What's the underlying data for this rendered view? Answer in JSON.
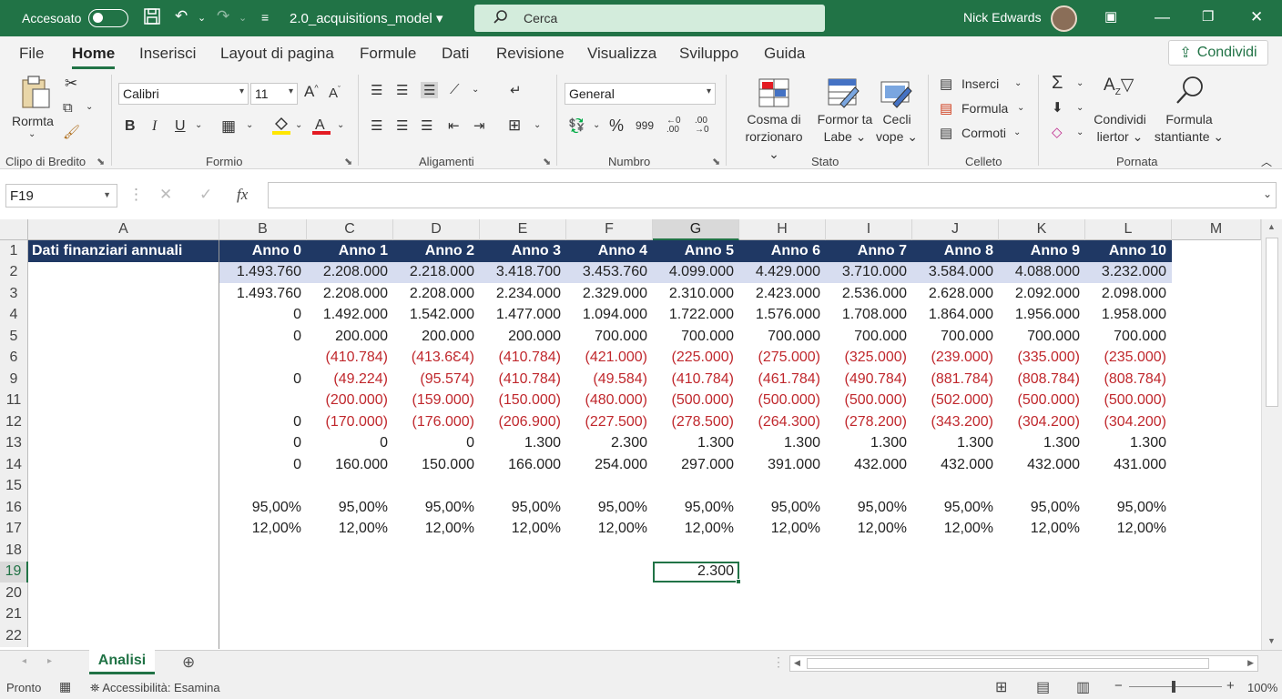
{
  "titlebar": {
    "autosave_label": "Accesoato",
    "filename": "2.0_acquisitions_model",
    "search_placeholder": "Cerca",
    "user_name": "Nick Edwards"
  },
  "ribbon_tabs": [
    "File",
    "Home",
    "Inserisci",
    "Layout di pagina",
    "Formule",
    "Dati",
    "Revisione",
    "Visualizza",
    "Sviluppo",
    "Guida"
  ],
  "share_label": "Condividi",
  "ribbon": {
    "paste_label": "Rormta",
    "font_name": "Calibri",
    "font_size": "11",
    "number_format": "General",
    "cond_format_label_1": "Cosma di",
    "cond_format_label_2": "rorzionaro",
    "format_table_label_1": "Formor ta",
    "format_table_label_2": "Labe",
    "cell_styles_label_1": "Cecli",
    "cell_styles_label_2": "vope",
    "insert_label": "Inserci",
    "format_label": "Formula",
    "delete_label": "Cormoti",
    "sort_label_1": "Condividi",
    "sort_label_2": "liertor",
    "find_label_1": "Formula",
    "find_label_2": "stantiante",
    "groups": {
      "clipboard": "Clipo di Bredito",
      "font": "Formio",
      "alignment": "Aligamenti",
      "number": "Numbro",
      "styles": "Stato",
      "cells": "Celleto",
      "editing": "Pornata"
    }
  },
  "formula_bar": {
    "name_box": "F19",
    "formula": ""
  },
  "sheet": {
    "columns": [
      "A",
      "B",
      "C",
      "D",
      "E",
      "F",
      "G",
      "H",
      "I",
      "J",
      "K",
      "L",
      "M"
    ],
    "selected_column": "G",
    "row_numbers": [
      "1",
      "2",
      "3",
      "4",
      "5",
      "6",
      "9",
      "11",
      "12",
      "13",
      "14",
      "15",
      "16",
      "17",
      "18",
      "19",
      "20",
      "21",
      "22"
    ],
    "selected_row": "19",
    "header_title": "Dati finanziari annuali",
    "years": [
      "Anno 0",
      "Anno 1",
      "Anno 2",
      "Anno 3",
      "Anno 4",
      "Anno 5",
      "Anno 6",
      "Anno 7",
      "Anno 8",
      "Anno 9",
      "Anno 10"
    ],
    "rows": [
      [
        "1.493.760",
        "2.208.000",
        "2.218.000",
        "3.418.700",
        "3.453.760",
        "4.099.000",
        "4.429.000",
        "3.710.000",
        "3.584.000",
        "4.088.000",
        "3.232.000"
      ],
      [
        "1.493.760",
        "2.208.000",
        "2.208.000",
        "2.234.000",
        "2.329.000",
        "2.310.000",
        "2.423.000",
        "2.536.000",
        "2.628.000",
        "2.092.000",
        "2.098.000"
      ],
      [
        "0",
        "1.492.000",
        "1.542.000",
        "1.477.000",
        "1.094.000",
        "1.722.000",
        "1.576.000",
        "1.708.000",
        "1.864.000",
        "1.956.000",
        "1.958.000"
      ],
      [
        "0",
        "200.000",
        "200.000",
        "200.000",
        "700.000",
        "700.000",
        "700.000",
        "700.000",
        "700.000",
        "700.000",
        "700.000"
      ],
      [
        "",
        "(410.784)",
        "(413.6Ɛ4)",
        "(410.784)",
        "(421.000)",
        "(225.000)",
        "(275.000)",
        "(325.000)",
        "(239.000)",
        "(335.000)",
        "(235.000)"
      ],
      [
        "0",
        "(49.224)",
        "(95.574)",
        "(410.784)",
        "(49.584)",
        "(410.784)",
        "(461.784)",
        "(490.784)",
        "(881.784)",
        "(808.784)",
        "(808.784)"
      ],
      [
        "",
        "(200.000)",
        "(159.000)",
        "(150.000)",
        "(480.000)",
        "(500.000)",
        "(500.000)",
        "(500.000)",
        "(502.000)",
        "(500.000)",
        "(500.000)"
      ],
      [
        "0",
        "(170.000)",
        "(176.000)",
        "(206.900)",
        "(227.500)",
        "(278.500)",
        "(264.300)",
        "(278.200)",
        "(343.200)",
        "(304.200)",
        "(304.200)"
      ],
      [
        "0",
        "0",
        "0",
        "1.300",
        "2.300",
        "1.300",
        "1.300",
        "1.300",
        "1.300",
        "1.300",
        "1.300"
      ],
      [
        "0",
        "160.000",
        "150.000",
        "166.000",
        "254.000",
        "297.000",
        "391.000",
        "432.000",
        "432.000",
        "432.000",
        "431.000"
      ],
      [
        "",
        "",
        "",
        "",
        "",
        "",
        "",
        "",
        "",
        "",
        ""
      ],
      [
        "95,00%",
        "95,00%",
        "95,00%",
        "95,00%",
        "95,00%",
        "95,00%",
        "95,00%",
        "95,00%",
        "95,00%",
        "95,00%",
        "95,00%"
      ],
      [
        "12,00%",
        "12,00%",
        "12,00%",
        "12,00%",
        "12,00%",
        "12,00%",
        "12,00%",
        "12,00%",
        "12,00%",
        "12,00%",
        "12,00%"
      ]
    ],
    "active_cell_value": "2.300"
  },
  "sheet_tabs": [
    "Analisi"
  ],
  "statusbar": {
    "ready": "Pronto",
    "accessibility": "Accessibilità: Esamina",
    "zoom": "100%"
  },
  "colors": {
    "accent": "#217346",
    "header_fill": "#1f3864",
    "highlight_row": "#d7ddf0",
    "negative": "#c0282d"
  }
}
